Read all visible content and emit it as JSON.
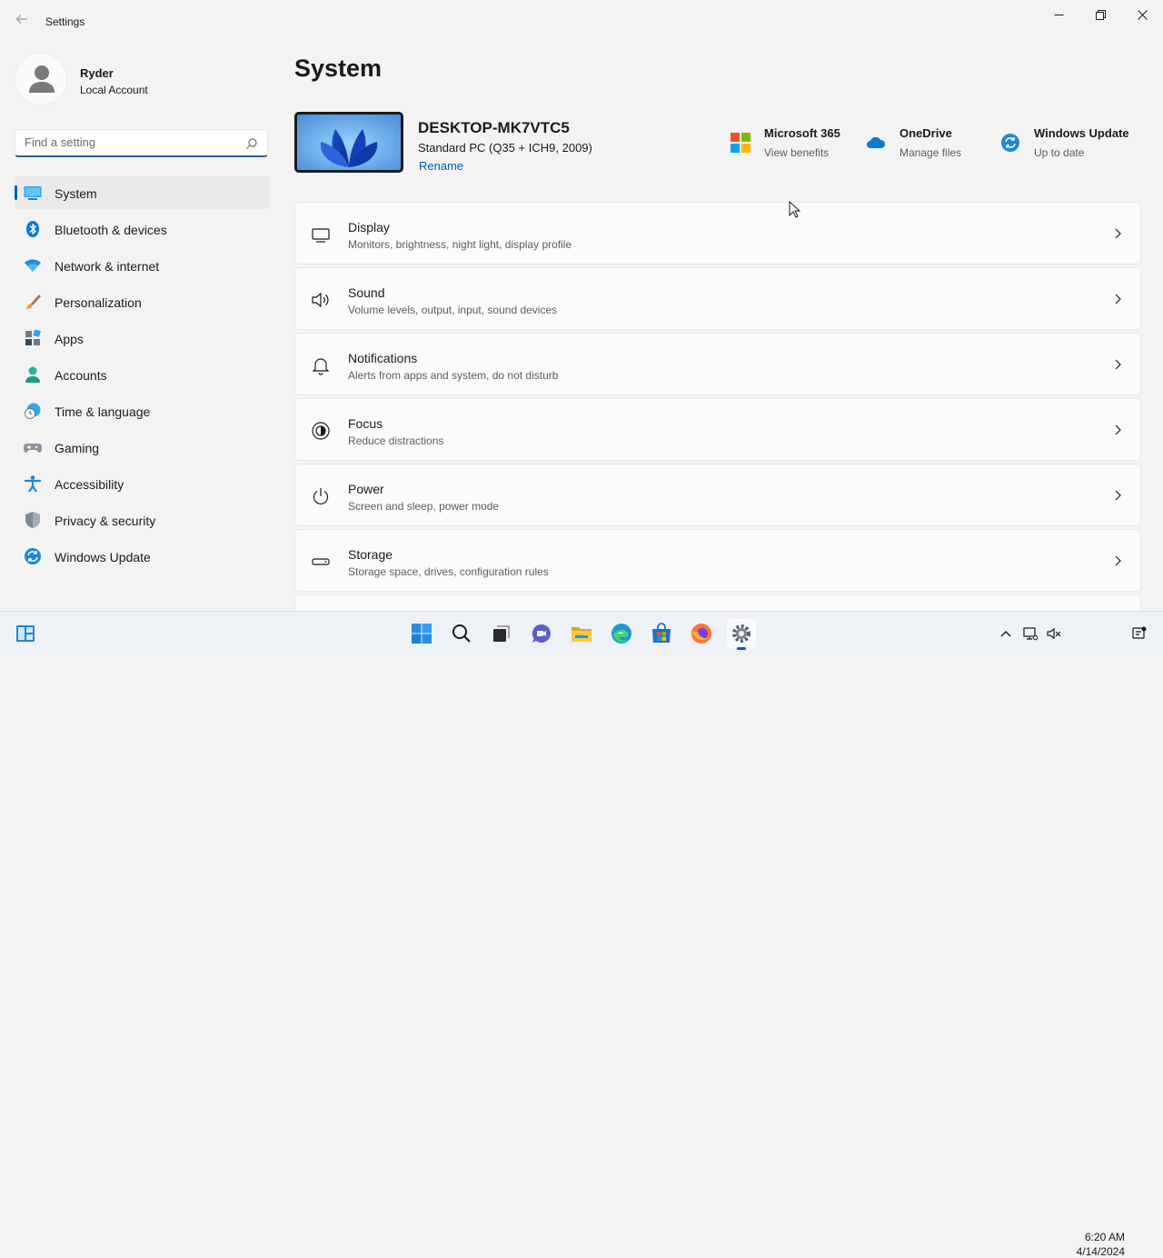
{
  "window": {
    "title": "Settings"
  },
  "profile": {
    "name": "Ryder",
    "account_type": "Local Account"
  },
  "search": {
    "placeholder": "Find a setting"
  },
  "sidebar": {
    "items": [
      {
        "label": "System",
        "icon": "system-icon",
        "active": true
      },
      {
        "label": "Bluetooth & devices",
        "icon": "bluetooth-icon"
      },
      {
        "label": "Network & internet",
        "icon": "wifi-icon"
      },
      {
        "label": "Personalization",
        "icon": "brush-icon"
      },
      {
        "label": "Apps",
        "icon": "apps-icon"
      },
      {
        "label": "Accounts",
        "icon": "accounts-icon"
      },
      {
        "label": "Time & language",
        "icon": "clock-globe-icon"
      },
      {
        "label": "Gaming",
        "icon": "gamepad-icon"
      },
      {
        "label": "Accessibility",
        "icon": "accessibility-icon"
      },
      {
        "label": "Privacy & security",
        "icon": "shield-icon"
      },
      {
        "label": "Windows Update",
        "icon": "update-icon"
      }
    ]
  },
  "main": {
    "title": "System",
    "device": {
      "name": "DESKTOP-MK7VTC5",
      "model": "Standard PC (Q35 + ICH9, 2009)",
      "rename_label": "Rename"
    },
    "quick_links": [
      {
        "title": "Microsoft 365",
        "subtitle": "View benefits",
        "icon": "microsoft-logo-icon"
      },
      {
        "title": "OneDrive",
        "subtitle": "Manage files",
        "icon": "cloud-icon"
      },
      {
        "title": "Windows Update",
        "subtitle": "Up to date",
        "icon": "update-icon"
      }
    ],
    "cards": [
      {
        "title": "Display",
        "subtitle": "Monitors, brightness, night light, display profile",
        "icon": "monitor-icon"
      },
      {
        "title": "Sound",
        "subtitle": "Volume levels, output, input, sound devices",
        "icon": "speaker-icon"
      },
      {
        "title": "Notifications",
        "subtitle": "Alerts from apps and system, do not disturb",
        "icon": "bell-icon"
      },
      {
        "title": "Focus",
        "subtitle": "Reduce distractions",
        "icon": "focus-icon"
      },
      {
        "title": "Power",
        "subtitle": "Screen and sleep, power mode",
        "icon": "power-icon"
      },
      {
        "title": "Storage",
        "subtitle": "Storage space, drives, configuration rules",
        "icon": "storage-icon"
      }
    ]
  },
  "taskbar": {
    "apps": [
      "widgets-icon",
      "start-icon",
      "search-icon",
      "task-view-icon",
      "chat-icon",
      "file-explorer-icon",
      "edge-icon",
      "store-icon",
      "firefox-icon",
      "settings-icon"
    ],
    "clock": {
      "time": "6:20 AM",
      "date": "4/14/2024"
    }
  },
  "colors": {
    "accent": "#005fb8",
    "background": "#f3f3f3",
    "card": "#fbfbfb"
  }
}
